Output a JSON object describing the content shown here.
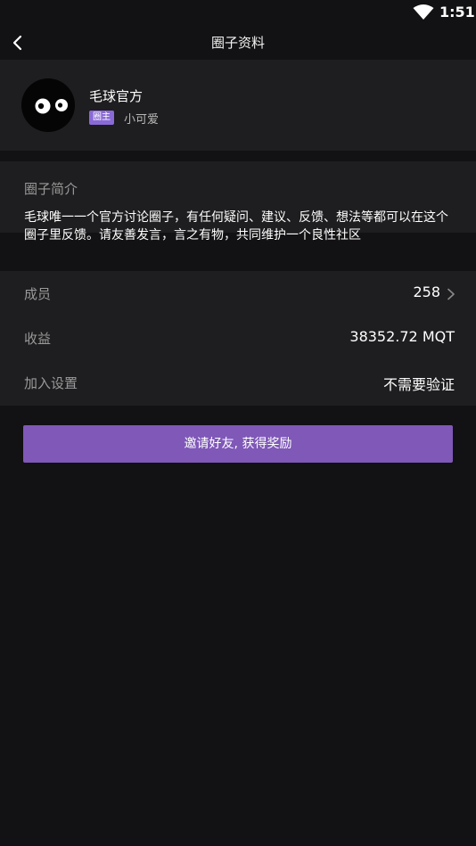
{
  "status_bar": {
    "time": "1:51"
  },
  "nav": {
    "title": "圈子资料"
  },
  "profile": {
    "name": "毛球官方",
    "owner_badge": "圈主",
    "owner_name": "小可爱"
  },
  "intro": {
    "title": "圈子简介",
    "text": "毛球唯一一个官方讨论圈子，有任何疑问、建议、反馈、想法等都可以在这个圈子里反馈。请友善发言，言之有物，共同维护一个良性社区"
  },
  "info": {
    "members_label": "成员",
    "members_value": "258",
    "earnings_label": "收益",
    "earnings_value": "38352.72 MQT",
    "join_label": "加入设置",
    "join_value": "不需要验证"
  },
  "invite_button": {
    "label": "邀请好友, 获得奖励"
  },
  "colors": {
    "background": "#121113",
    "card": "#1e1d1f",
    "accent": "#7f58b8",
    "badge": "#8a6ad6"
  }
}
